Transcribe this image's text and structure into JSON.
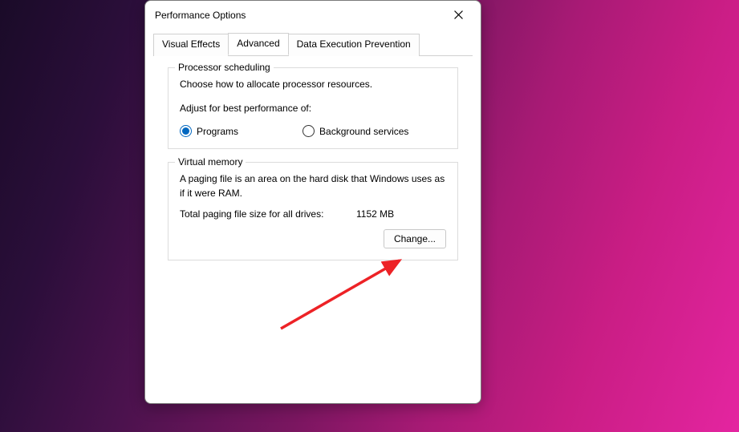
{
  "dialog": {
    "title": "Performance Options",
    "tabs": [
      {
        "label": "Visual Effects"
      },
      {
        "label": "Advanced"
      },
      {
        "label": "Data Execution Prevention"
      }
    ]
  },
  "processor": {
    "group_title": "Processor scheduling",
    "description": "Choose how to allocate processor resources.",
    "subheading": "Adjust for best performance of:",
    "options": {
      "programs": "Programs",
      "background": "Background services"
    }
  },
  "virtual_memory": {
    "group_title": "Virtual memory",
    "description": "A paging file is an area on the hard disk that Windows uses as if it were RAM.",
    "total_label": "Total paging file size for all drives:",
    "total_value": "1152 MB",
    "change_button": "Change..."
  }
}
